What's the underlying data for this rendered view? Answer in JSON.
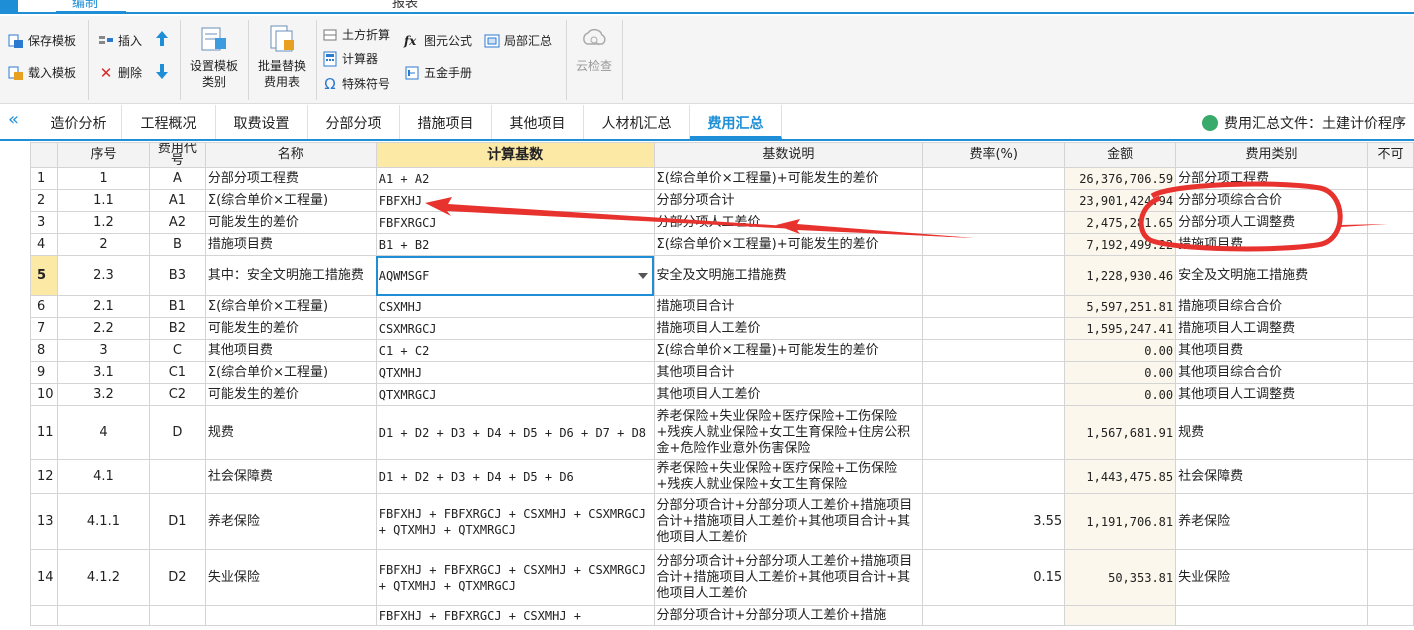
{
  "menubar": {
    "tabs": [
      "编制",
      "报表"
    ]
  },
  "ribbon": {
    "save_template": "保存模板",
    "load_template": "载入模板",
    "insert": "插入",
    "delete": "删除",
    "set_template_category": [
      "设置模板",
      "类别"
    ],
    "batch_replace": [
      "批量替换",
      "费用表"
    ],
    "earthwork": "土方折算",
    "calculator": "计算器",
    "special_symbols": "特殊符号",
    "element_formula": "图元公式",
    "hardware_manual": "五金手册",
    "local_summary": "局部汇总",
    "cloud_check": "云检查"
  },
  "tabs": {
    "items": [
      "造价分析",
      "工程概况",
      "取费设置",
      "分部分项",
      "措施项目",
      "其他项目",
      "人材机汇总",
      "费用汇总"
    ],
    "active_index": 7,
    "file_label": "费用汇总文件：土建计价程序"
  },
  "grid": {
    "headers": [
      "",
      "序号",
      "费用代号",
      "名称",
      "计算基数",
      "基数说明",
      "费率(%)",
      "金额",
      "费用类别",
      "不可"
    ],
    "selected_header_index": 4,
    "selected_row_index": 4,
    "rows": [
      {
        "rn": "1",
        "seq": "1",
        "code": "A",
        "name": "分部分项工程费",
        "base": "A1 + A2",
        "desc": "Σ(综合单价×工程量)+可能发生的差价",
        "rate": "",
        "amount": "26,376,706.59",
        "category": "分部分项工程费"
      },
      {
        "rn": "2",
        "seq": "1.1",
        "code": "A1",
        "name": "Σ(综合单价×工程量)",
        "base": "FBFXHJ",
        "desc": "分部分项合计",
        "rate": "",
        "amount": "23,901,424.94",
        "category": "分部分项综合合价"
      },
      {
        "rn": "3",
        "seq": "1.2",
        "code": "A2",
        "name": "可能发生的差价",
        "base": "FBFXRGCJ",
        "desc": "分部分项人工差价",
        "rate": "",
        "amount": "2,475,281.65",
        "category": "分部分项人工调整费"
      },
      {
        "rn": "4",
        "seq": "2",
        "code": "B",
        "name": "措施项目费",
        "base": "B1 + B2",
        "desc": "Σ(综合单价×工程量)+可能发生的差价",
        "rate": "",
        "amount": "7,192,499.22",
        "category": "措施项目费"
      },
      {
        "rn": "5",
        "seq": "2.3",
        "code": "B3",
        "name": "其中：安全文明施工措施费",
        "base": "AQWMSGF",
        "desc": "安全及文明施工措施费",
        "rate": "",
        "amount": "1,228,930.46",
        "category": "安全及文明施工措施费"
      },
      {
        "rn": "6",
        "seq": "2.1",
        "code": "B1",
        "name": "Σ(综合单价×工程量)",
        "base": "CSXMHJ",
        "desc": "措施项目合计",
        "rate": "",
        "amount": "5,597,251.81",
        "category": "措施项目综合合价"
      },
      {
        "rn": "7",
        "seq": "2.2",
        "code": "B2",
        "name": "可能发生的差价",
        "base": "CSXMRGCJ",
        "desc": "措施项目人工差价",
        "rate": "",
        "amount": "1,595,247.41",
        "category": "措施项目人工调整费"
      },
      {
        "rn": "8",
        "seq": "3",
        "code": "C",
        "name": "其他项目费",
        "base": "C1 + C2",
        "desc": "Σ(综合单价×工程量)+可能发生的差价",
        "rate": "",
        "amount": "0.00",
        "category": "其他项目费"
      },
      {
        "rn": "9",
        "seq": "3.1",
        "code": "C1",
        "name": "Σ(综合单价×工程量)",
        "base": "QTXMHJ",
        "desc": "其他项目合计",
        "rate": "",
        "amount": "0.00",
        "category": "其他项目综合合价"
      },
      {
        "rn": "10",
        "seq": "3.2",
        "code": "C2",
        "name": "可能发生的差价",
        "base": "QTXMRGCJ",
        "desc": "其他项目人工差价",
        "rate": "",
        "amount": "0.00",
        "category": "其他项目人工调整费"
      },
      {
        "rn": "11",
        "seq": "4",
        "code": "D",
        "name": "规费",
        "base": "D1 + D2 + D3 + D4 + D5 + D6 + D7 + D8",
        "desc": "养老保险+失业保险+医疗保险+工伤保险+残疾人就业保险+女工生育保险+住房公积金+危险作业意外伤害保险",
        "rate": "",
        "amount": "1,567,681.91",
        "category": "规费"
      },
      {
        "rn": "12",
        "seq": "4.1",
        "code": "",
        "name": "社会保障费",
        "base": "D1 + D2 + D3 + D4 + D5 + D6",
        "desc": "养老保险+失业保险+医疗保险+工伤保险+残疾人就业保险+女工生育保险",
        "rate": "",
        "amount": "1,443,475.85",
        "category": "社会保障费"
      },
      {
        "rn": "13",
        "seq": "4.1.1",
        "code": "D1",
        "name": "养老保险",
        "base": "FBFXHJ + FBFXRGCJ + CSXMHJ + CSXMRGCJ + QTXMHJ + QTXMRGCJ",
        "desc": "分部分项合计+分部分项人工差价+措施项目合计+措施项目人工差价+其他项目合计+其他项目人工差价",
        "rate": "3.55",
        "amount": "1,191,706.81",
        "category": "养老保险"
      },
      {
        "rn": "14",
        "seq": "4.1.2",
        "code": "D2",
        "name": "失业保险",
        "base": "FBFXHJ + FBFXRGCJ + CSXMHJ + CSXMRGCJ + QTXMHJ + QTXMRGCJ",
        "desc": "分部分项合计+分部分项人工差价+措施项目合计+措施项目人工差价+其他项目合计+其他项目人工差价",
        "rate": "0.15",
        "amount": "50,353.81",
        "category": "失业保险"
      },
      {
        "rn": "",
        "seq": "",
        "code": "",
        "name": "",
        "base": "FBFXHJ + FBFXRGCJ + CSXMHJ +",
        "desc": "分部分项合计+分部分项人工差价+措施",
        "rate": "",
        "amount": "",
        "category": ""
      }
    ]
  },
  "colors": {
    "accent": "#1e8fd6",
    "selected_header": "#fde9a6",
    "annotation": "#e8322e"
  }
}
